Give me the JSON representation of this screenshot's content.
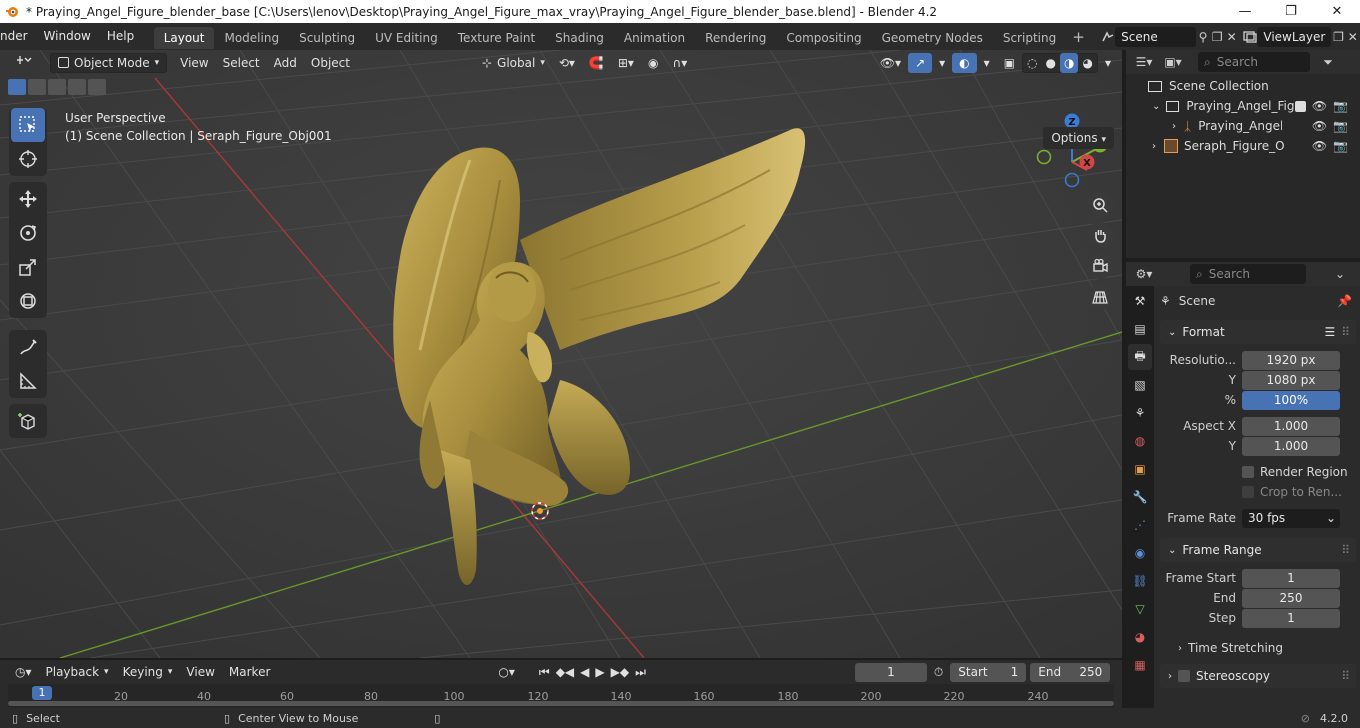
{
  "window": {
    "title": "* Praying_Angel_Figure_blender_base [C:\\Users\\lenov\\Desktop\\Praying_Angel_Figure_max_vray\\Praying_Angel_Figure_blender_base.blend] - Blender 4.2",
    "minimize": "—",
    "maximize": "❐",
    "close": "✕"
  },
  "menu": {
    "items": [
      "nder",
      "Window",
      "Help"
    ]
  },
  "workspaces": [
    "Layout",
    "Modeling",
    "Sculpting",
    "UV Editing",
    "Texture Paint",
    "Shading",
    "Animation",
    "Rendering",
    "Compositing",
    "Geometry Nodes",
    "Scripting"
  ],
  "active_workspace": "Layout",
  "scene_selector": {
    "value": "Scene"
  },
  "viewlayer_selector": {
    "value": "ViewLayer"
  },
  "viewport": {
    "mode": "Object Mode",
    "menus": [
      "View",
      "Select",
      "Add",
      "Object"
    ],
    "orientation": "Global",
    "info_line1": "User Perspective",
    "info_line2": "(1) Scene Collection | Seraph_Figure_Obj001",
    "options": "Options",
    "gizmo_labels": {
      "x": "X",
      "y": "Y",
      "z": "Z"
    }
  },
  "outliner": {
    "search_placeholder": "Search",
    "rows": [
      {
        "label": "Scene Collection"
      },
      {
        "label": "Praying_Angel_Figu"
      },
      {
        "label": "Praying_Angel_"
      },
      {
        "label": "Seraph_Figure_Obj"
      }
    ]
  },
  "properties": {
    "search_placeholder": "Search",
    "context": "Scene",
    "format": {
      "title": "Format",
      "resolution_label": "Resolutio...",
      "res_x": "1920 px",
      "y_label": "Y",
      "res_y": "1080 px",
      "percent_label": "%",
      "percent": "100%",
      "aspect_label": "Aspect X",
      "aspect_x": "1.000",
      "aspect_y_label": "Y",
      "aspect_y": "1.000",
      "render_region": "Render Region",
      "crop": "Crop to Ren...",
      "frame_rate_label": "Frame Rate",
      "frame_rate": "30 fps"
    },
    "frame_range": {
      "title": "Frame Range",
      "start_label": "Frame Start",
      "start": "1",
      "end_label": "End",
      "end": "250",
      "step_label": "Step",
      "step": "1"
    },
    "time_stretching": "Time Stretching",
    "stereoscopy": "Stereoscopy"
  },
  "timeline": {
    "menus": [
      "Playback",
      "Keying",
      "View",
      "Marker"
    ],
    "current_frame": "1",
    "start_label": "Start",
    "start": "1",
    "end_label": "End",
    "end": "250",
    "ruler_current": "1",
    "ticks": [
      "20",
      "40",
      "60",
      "80",
      "100",
      "120",
      "140",
      "160",
      "180",
      "200",
      "220",
      "240"
    ]
  },
  "statusbar": {
    "select": "Select",
    "center_view": "Center View to Mouse",
    "version": "4.2.0"
  },
  "colors": {
    "accent": "#4772b3",
    "gold": "#a8933f",
    "grid_x": "#b23a3a",
    "grid_y": "#6e9a2a"
  }
}
